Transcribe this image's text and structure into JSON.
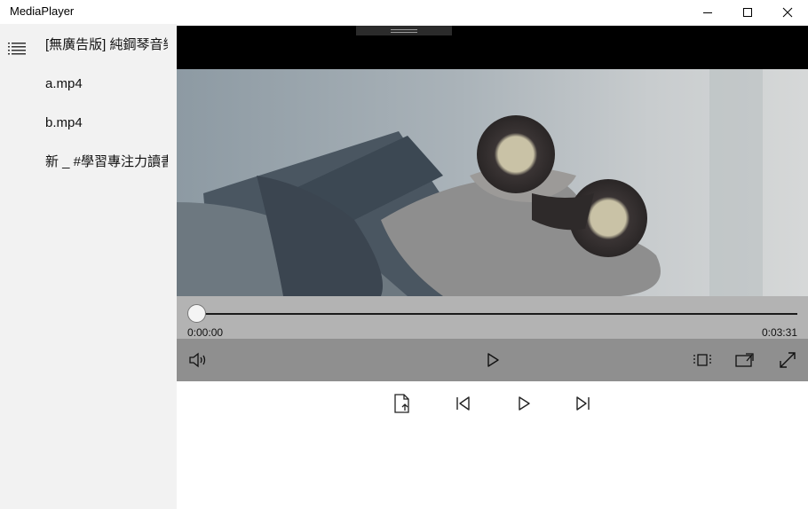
{
  "window": {
    "title": "MediaPlayer",
    "buttons": [
      "minimize-icon",
      "maximize-icon",
      "close-icon"
    ]
  },
  "sidebar": {
    "menu_icon": "hamburger-list-icon",
    "items": [
      {
        "label": "[無廣告版] 純鋼琴音樂"
      },
      {
        "label": "a.mp4"
      },
      {
        "label": "b.mp4"
      },
      {
        "label": "新 _ #學習專注力讀書"
      }
    ]
  },
  "player": {
    "progress": 0.0,
    "current_time": "0:00:00",
    "total_time": "0:03:31",
    "controls": {
      "volume": "volume-icon",
      "play": "play-icon",
      "aspect": "aspect-ratio-icon",
      "cast": "cast-to-device-icon",
      "fullscreen": "fullscreen-icon"
    }
  },
  "bottom_toolbar": [
    "open-file-icon",
    "previous-track-icon",
    "play-icon",
    "next-track-icon"
  ],
  "colors": {
    "sidebar_bg": "#f2f2f2",
    "control_bar_upper": "#b3b3b3",
    "control_bar_lower": "#8f8f8f",
    "letterbox": "#000000"
  }
}
